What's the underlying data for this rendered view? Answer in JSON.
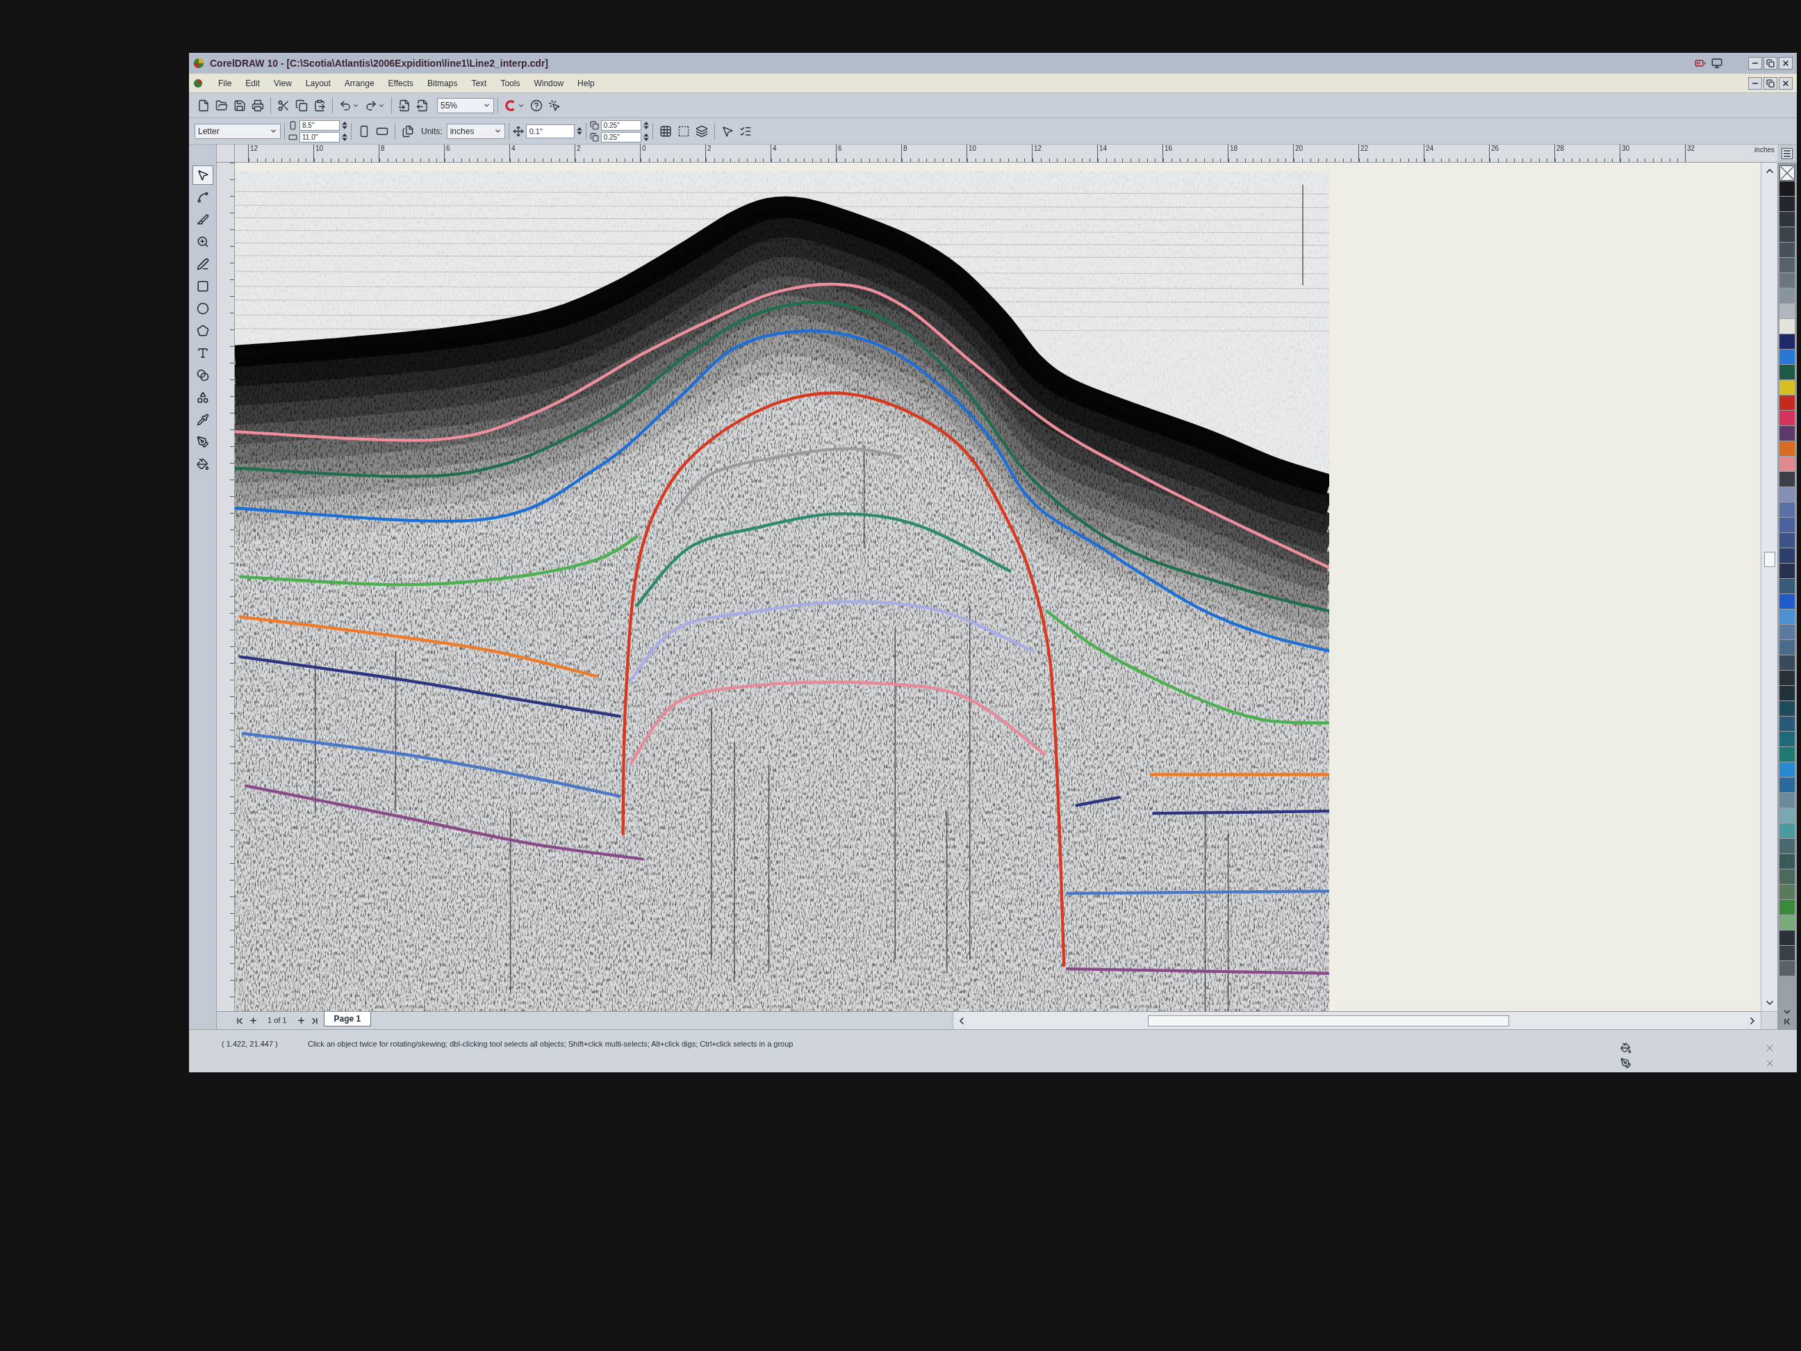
{
  "window": {
    "title": "CorelDRAW 10 - [C:\\Scotia\\Atlantis\\2006Expidition\\line1\\Line2_interp.cdr]"
  },
  "menu": [
    "File",
    "Edit",
    "View",
    "Layout",
    "Arrange",
    "Effects",
    "Bitmaps",
    "Text",
    "Tools",
    "Window",
    "Help"
  ],
  "standard_toolbar": {
    "zoom_level": "55%"
  },
  "property_bar": {
    "paper_type": "Letter",
    "page_width": "8.5\"",
    "page_height": "11.0\"",
    "units_label": "Units:",
    "units": "inches",
    "nudge": "0.1\"",
    "duplicate_x": "0.25\"",
    "duplicate_y": "0.25\""
  },
  "ruler": {
    "labels": [
      "12",
      "10",
      "8",
      "6",
      "4",
      "2",
      "0",
      "2",
      "4",
      "6",
      "8",
      "10",
      "12",
      "14",
      "16",
      "18",
      "20",
      "22",
      "24",
      "26",
      "28",
      "30",
      "32"
    ],
    "unit": "inches"
  },
  "toolbox": [
    {
      "selected": true
    },
    {
      "selected": false
    },
    {
      "selected": false
    },
    {
      "selected": false
    },
    {
      "selected": false
    },
    {
      "selected": false
    },
    {
      "selected": false
    },
    {
      "selected": false
    },
    {
      "selected": false
    },
    {
      "selected": false
    },
    {
      "selected": false
    },
    {
      "selected": false
    },
    {
      "selected": false
    },
    {
      "selected": false
    }
  ],
  "page_navigation": {
    "page_count": "1 of 1",
    "tabs": [
      {
        "label": "Page 1",
        "selected": true
      }
    ]
  },
  "status_bar": {
    "coordinates": "( 1.422, 21.447 )",
    "hint": "Click an object twice for rotating/skewing; dbl-clicking tool selects all objects; Shift+click multi-selects; Alt+click digs; Ctrl+click selects in a group"
  },
  "palette": [
    {
      "color": "#1a1a1c"
    },
    {
      "color": "#24282e"
    },
    {
      "color": "#2f353c"
    },
    {
      "color": "#3b424a"
    },
    {
      "color": "#48515a"
    },
    {
      "color": "#58626c"
    },
    {
      "color": "#6b7680"
    },
    {
      "color": "#8a949e"
    },
    {
      "color": "#b0b8be"
    },
    {
      "color": "#e4e3dc"
    },
    {
      "color": "#1e2a68"
    },
    {
      "color": "#2a78d6"
    },
    {
      "color": "#1f5a46"
    },
    {
      "color": "#d6bf22"
    },
    {
      "color": "#c62a1e"
    },
    {
      "color": "#d6305c"
    },
    {
      "color": "#5c3a6a"
    },
    {
      "color": "#d86a22"
    },
    {
      "color": "#e08a8e"
    },
    {
      "color": "#3a3f48"
    },
    {
      "color": "#8290b8"
    },
    {
      "color": "#5c70a8"
    },
    {
      "color": "#4a62a0"
    },
    {
      "color": "#3e528a"
    },
    {
      "color": "#2e3e6a"
    },
    {
      "color": "#283250"
    },
    {
      "color": "#3a5a7a"
    },
    {
      "color": "#1e5ac8"
    },
    {
      "color": "#4c92d2"
    },
    {
      "color": "#5a7aa0"
    },
    {
      "color": "#4a6a8a"
    },
    {
      "color": "#3a4a5a"
    },
    {
      "color": "#2a3038"
    },
    {
      "color": "#22303a"
    },
    {
      "color": "#1e4a5a"
    },
    {
      "color": "#2a5a7a"
    },
    {
      "color": "#1e6a7a"
    },
    {
      "color": "#1e7a70"
    },
    {
      "color": "#2a8ad0"
    },
    {
      "color": "#2a6a9a"
    },
    {
      "color": "#6a8a9a"
    },
    {
      "color": "#7aa8b0"
    },
    {
      "color": "#4a9aa0"
    },
    {
      "color": "#4a6a70"
    },
    {
      "color": "#3a5a5a"
    },
    {
      "color": "#4a6a5a"
    },
    {
      "color": "#5a7a5a"
    },
    {
      "color": "#3a8a3a"
    },
    {
      "color": "#7aaa7a"
    },
    {
      "color": "#2b3139"
    },
    {
      "color": "#3a4048"
    },
    {
      "color": "#5a6068"
    }
  ]
}
